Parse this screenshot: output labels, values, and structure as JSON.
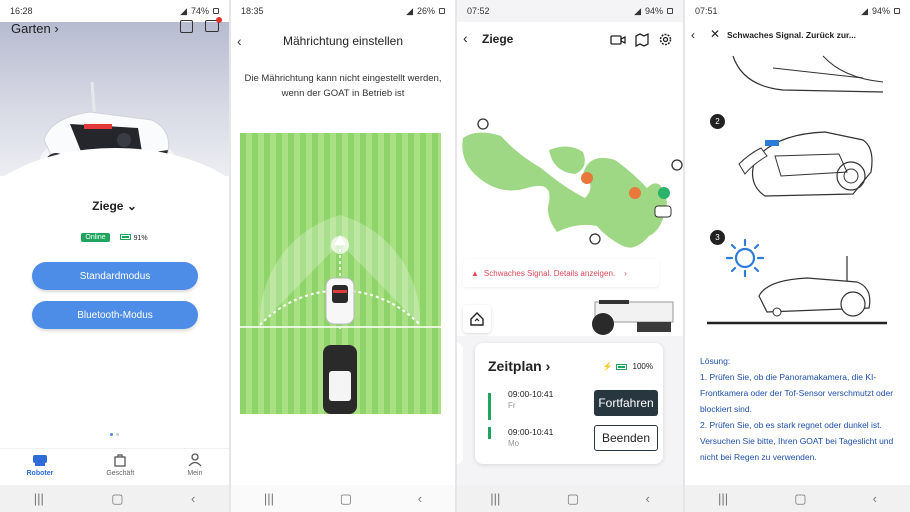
{
  "panel1": {
    "status": {
      "time": "16:28",
      "battery": "74%"
    },
    "location": "Garten",
    "device": "Ziege",
    "online": "Online",
    "battery": "91%",
    "buttons": {
      "standard": "Standardmodus",
      "bluetooth": "Bluetooth-Modus"
    },
    "tabs": [
      {
        "label": "Roboter"
      },
      {
        "label": "Geschäft"
      },
      {
        "label": "Mein"
      }
    ]
  },
  "panel2": {
    "status": {
      "time": "18:35",
      "battery": "26%"
    },
    "title": "Mährichtung einstellen",
    "message": "Die Mährichtung kann nicht eingestellt werden, wenn der GOAT in Betrieb ist"
  },
  "panel3": {
    "status": {
      "time": "07:52",
      "battery": "94%"
    },
    "device": "Ziege",
    "signal": "Schwaches Signal. Details anzeigen.",
    "schedule": {
      "title": "Zeitplan",
      "battery": "100%",
      "items": [
        {
          "time": "09:00-10:41",
          "day": "Fr",
          "button": "Fortfahren"
        },
        {
          "time": "09:00-10:41",
          "day": "Mo",
          "button": "Beenden"
        }
      ]
    }
  },
  "panel4": {
    "status": {
      "time": "07:51",
      "battery": "94%"
    },
    "title": "Schwaches Signal. Zurück zur...",
    "steps": [
      "2",
      "3"
    ],
    "solution": {
      "heading": "Lösung:",
      "items": [
        "1. Prüfen Sie, ob die Panoramakamera, die KI-Frontkamera oder der Tof-Sensor verschmutzt oder blockiert sind.",
        "2. Prüfen Sie, ob es stark regnet oder dunkel ist. Versuchen Sie bitte, Ihren GOAT bei Tageslicht und nicht bei Regen zu verwenden."
      ]
    }
  },
  "colors": {
    "accent": "#4d8de8",
    "grass": "#8ed46a",
    "map": "#9ed884",
    "alert": "#e2475c",
    "green": "#1ea45c"
  }
}
